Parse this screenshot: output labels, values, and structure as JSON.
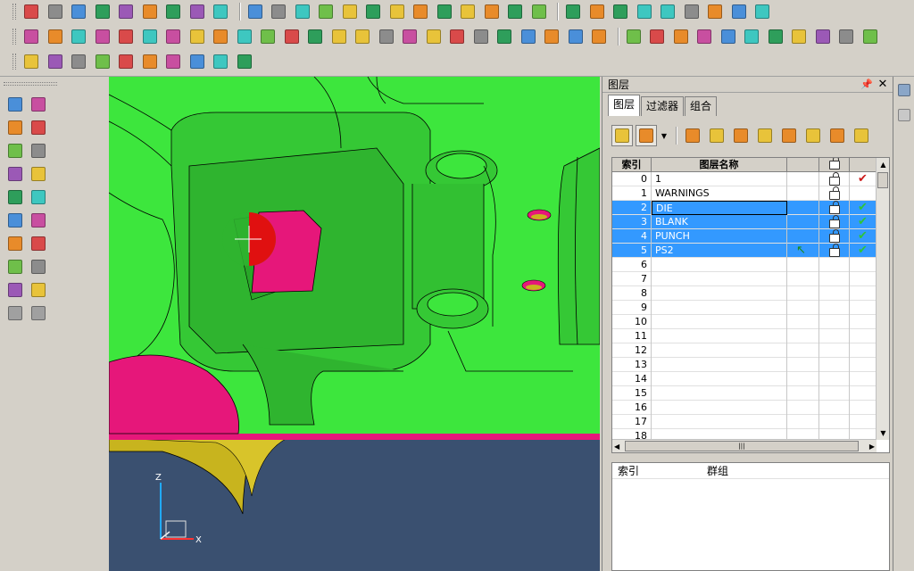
{
  "panel": {
    "title": "图层",
    "pin_glyph": "📌",
    "close_glyph": "✕",
    "tabs": [
      {
        "label": "图层",
        "active": true
      },
      {
        "label": "过滤器",
        "active": false
      },
      {
        "label": "组合",
        "active": false
      }
    ],
    "grid": {
      "headers": {
        "index": "索引",
        "name": "图层名称",
        "blank": "",
        "lock": "",
        "visible": ""
      },
      "rows": [
        {
          "index": "0",
          "name": "1",
          "selected": false,
          "locked": true,
          "visible": true,
          "check_color": "#cc1a1a"
        },
        {
          "index": "1",
          "name": "WARNINGS",
          "selected": false,
          "locked": true,
          "visible": false,
          "check_color": ""
        },
        {
          "index": "2",
          "name": "DIE",
          "selected": true,
          "locked": true,
          "visible": true,
          "check_color": "#2fc43a",
          "editing": true
        },
        {
          "index": "3",
          "name": "BLANK",
          "selected": true,
          "locked": true,
          "visible": true,
          "check_color": "#2fc43a"
        },
        {
          "index": "4",
          "name": "PUNCH",
          "selected": true,
          "locked": true,
          "visible": true,
          "check_color": "#2fc43a"
        },
        {
          "index": "5",
          "name": "PS2",
          "selected": true,
          "locked": true,
          "visible": true,
          "check_color": "#2fc43a"
        },
        {
          "index": "6",
          "name": ""
        },
        {
          "index": "7",
          "name": ""
        },
        {
          "index": "8",
          "name": ""
        },
        {
          "index": "9",
          "name": ""
        },
        {
          "index": "10",
          "name": ""
        },
        {
          "index": "11",
          "name": ""
        },
        {
          "index": "12",
          "name": ""
        },
        {
          "index": "13",
          "name": ""
        },
        {
          "index": "14",
          "name": ""
        },
        {
          "index": "15",
          "name": ""
        },
        {
          "index": "16",
          "name": ""
        },
        {
          "index": "17",
          "name": ""
        },
        {
          "index": "18",
          "name": ""
        }
      ],
      "hscroll_glyph": "|||"
    },
    "group_grid": {
      "headers": {
        "index": "索引",
        "group": "群组"
      }
    }
  },
  "viewport": {
    "axis": {
      "z_label": "Z",
      "x_label": "X"
    },
    "colors": {
      "background": "#3a5070",
      "surface": "#3de63d",
      "magenta": "#e6177a",
      "yellow": "#c8b41e",
      "red": "#e01010"
    }
  },
  "toolbars": {
    "row1_icons": [
      "new-file-icon",
      "open-file-icon",
      "open-recent-icon",
      "save-icon",
      "save-as-icon",
      "import-icon",
      "print-icon",
      "zoom-all-icon",
      "window-icon",
      "sep",
      "measure-icon",
      "transform-icon",
      "line-icon",
      "rotate-icon",
      "snap-icon",
      "view-iso-icon",
      "view-top-icon",
      "view-front-icon",
      "view-side-icon",
      "view-back-icon",
      "view-bottom-icon",
      "view-right-icon",
      "scale-1-1-icon",
      "sep",
      "layer-props-icon",
      "render-icon",
      "shade-icon",
      "wireframe-icon",
      "filter-icon",
      "light-icon",
      "hidden-line-icon",
      "tube-icon",
      "wire-icon"
    ],
    "row2_icons": [
      "cube-icon",
      "cylinder-icon",
      "cone-icon",
      "cone2-icon",
      "sphere-icon",
      "torus-icon",
      "fillet-icon",
      "blend-icon",
      "chamfer-icon",
      "box-icon",
      "shell-icon",
      "sweep-icon",
      "extrude-icon",
      "revolve-icon",
      "loft-icon",
      "boolean-icon",
      "offset-icon",
      "draft-icon",
      "trim-icon",
      "split-icon",
      "sew-icon",
      "heal-icon",
      "unite-icon",
      "subtract-icon",
      "intersect-icon",
      "sep",
      "solid-a-icon",
      "solid-b-icon",
      "solid-c-icon",
      "solid-d-icon",
      "solid-e-icon",
      "solid-f-icon",
      "solid-g-icon",
      "solid-h-icon",
      "solid-i-icon",
      "solid-j-icon",
      "solid-k-icon"
    ],
    "row3_icons": [
      "surf-a-icon",
      "surf-b-icon",
      "surf-c-icon",
      "surf-d-icon",
      "surf-e-icon",
      "surf-f-icon",
      "surf-g-icon",
      "surf-h-icon",
      "surf-i-icon",
      "surf-j-icon"
    ],
    "left_icons": [
      "select-icon",
      "pick-icon",
      "dim-icon",
      "dim2-icon",
      "analyze-icon",
      "note-icon",
      "curve-icon",
      "edit-curve-icon",
      "surface-icon",
      "plane-icon",
      "rotate-view-icon",
      "box-view-icon",
      "help-icon",
      "bracket-icon",
      "delete-icon",
      "undo-icon",
      "grid-icon",
      "folder-icon",
      "back-arrow-icon",
      "forward-arrow-icon"
    ]
  }
}
